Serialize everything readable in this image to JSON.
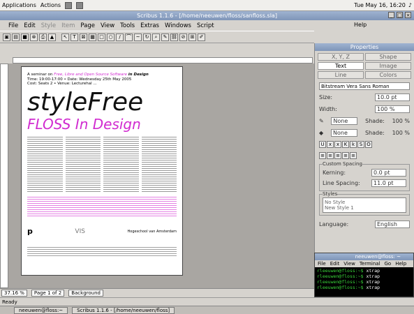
{
  "desktop": {
    "menus": [
      "Applications",
      "Actions"
    ],
    "clock": "Tue May 16, 16:20"
  },
  "window": {
    "title": "Scribus 1.1.6 - [/home/neeuwen/floss/sanfloss.sla]",
    "menu": [
      "File",
      "Edit",
      "Style",
      "Item",
      "Page",
      "View",
      "Tools",
      "Extras",
      "Windows",
      "Script"
    ],
    "help": "Help"
  },
  "document": {
    "line1_prefix": "A seminar on",
    "line1_emph": "Free, Libre and Open Source Software",
    "line1_suffix": "in Design",
    "line2": "Time: 19:00-17:00 • Date: Wednesday 25th May 2005",
    "line3": "Cost: Seats 2 • Venue: Lecturehal ...",
    "big_title": "styleFree",
    "big_subtitle": "FLOSS In Design",
    "logo_left": "p",
    "logo_middle": "VIS",
    "logo_right": "Hogeschool van Amsterdam"
  },
  "statusbar": {
    "zoom": "37.16 %",
    "page": "Page 1 of 2",
    "layer": "Background",
    "ready": "Ready"
  },
  "props": {
    "title": "Properties",
    "tabs": [
      "X, Y, Z",
      "Shape",
      "Text",
      "Image",
      "Line",
      "Colors"
    ],
    "selected_tab": "Text",
    "font": "Bitstream Vera Sans Roman",
    "size_label": "Size:",
    "size_value": "10.0 pt",
    "width_label": "Width:",
    "width_value": "100 %",
    "stroke_color": "None",
    "fill_color": "None",
    "shade_label": "Shade:",
    "shade_value": "100 %",
    "spacing_title": "Custom Spacing",
    "kerning_label": "Kerning:",
    "kerning_value": "0.0 pt",
    "line_spacing_label": "Line Spacing:",
    "line_spacing_value": "11.0 pt",
    "styles_title": "Styles",
    "styles": [
      "No Style",
      "New Style 1"
    ],
    "language_label": "Language:",
    "language_value": "English"
  },
  "terminal": {
    "title": "neeuwen@floss: ~",
    "menu": [
      "File",
      "Edit",
      "View",
      "Terminal",
      "Go",
      "Help"
    ],
    "lines": [
      {
        "prompt": "rleeuwen@floss:~$",
        "cmd": "xtrap"
      },
      {
        "prompt": "rleeuwen@floss:~$",
        "cmd": "xtrap"
      },
      {
        "prompt": "rleeuwen@floss:~$",
        "cmd": "xtrap"
      },
      {
        "prompt": "rleeuwen@floss:~$",
        "cmd": "xtrap"
      }
    ]
  },
  "taskbar": {
    "tasks": [
      "neeuwen@floss:~",
      "Scribus 1.1.6 - [/home/neeuwen/floss]"
    ]
  }
}
